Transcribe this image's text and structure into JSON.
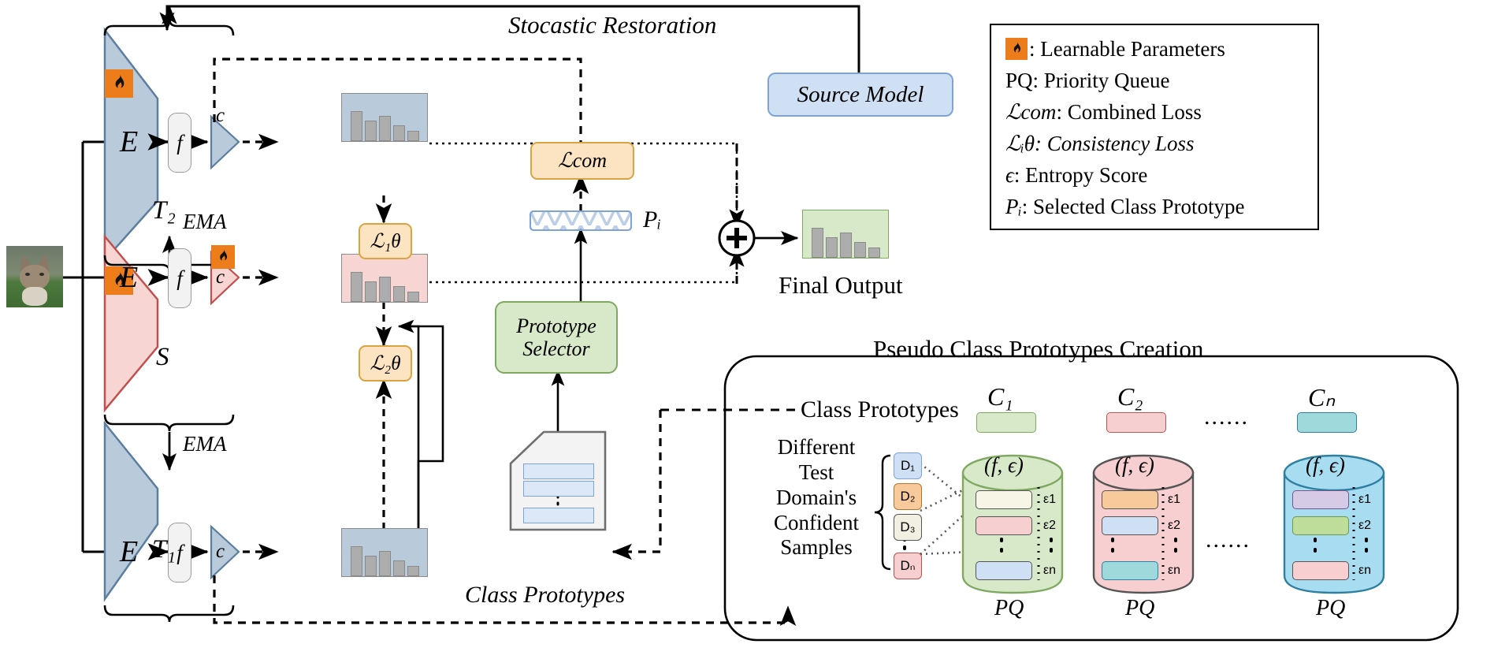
{
  "diagram": {
    "title_top": "Stocastic Restoration",
    "branches": [
      {
        "id": "T2",
        "label": "T₂",
        "encoder": "E",
        "feature": "f",
        "classifier": "c",
        "color": "#B9CBDB",
        "border": "#5C7E9E",
        "learnable_encoder": true,
        "learnable_classifier": false
      },
      {
        "id": "S",
        "label": "S",
        "encoder": "E",
        "feature": "f",
        "classifier": "c",
        "color": "#F6D5D3",
        "border": "#C0504D",
        "learnable_encoder": true,
        "learnable_classifier": true
      },
      {
        "id": "T1",
        "label": "T₁",
        "encoder": "E",
        "feature": "f",
        "classifier": "c",
        "color": "#B9CBDB",
        "border": "#5C7E9E",
        "learnable_encoder": false,
        "learnable_classifier": false
      }
    ],
    "ema_up_label": "EMA",
    "ema_down_label": "EMA",
    "losses": [
      {
        "id": "L1",
        "label": "ℒ₁θ"
      },
      {
        "id": "L2",
        "label": "ℒ₂θ"
      },
      {
        "id": "Lcom",
        "label": "ℒcom"
      }
    ],
    "pi_label": "Pᵢ",
    "prototype_selector": {
      "line1": "Prototype",
      "line2": "Selector"
    },
    "class_prototypes_caption": "Class Prototypes",
    "source_model": "Source Model",
    "final_output": "Final Output",
    "plus_symbol": "+"
  },
  "legend": {
    "items": [
      {
        "icon": "fire-icon",
        "key": "",
        "text": ": Learnable Parameters"
      },
      {
        "icon": "",
        "key": "PQ",
        "text": ": Priority Queue"
      },
      {
        "icon": "",
        "key": "ℒcom",
        "text": ": Combined Loss"
      },
      {
        "icon": "",
        "key": "ℒᵢθ",
        "text": ": Consistency Loss",
        "italic": true
      },
      {
        "icon": "",
        "key": "ϵ",
        "text": ": Entropy Score"
      },
      {
        "icon": "",
        "key": "Pᵢ",
        "text": ": Selected Class Prototype"
      }
    ]
  },
  "pseudo_panel": {
    "title": "Pseudo Class Prototypes Creation",
    "class_prototypes_label": "Class Prototypes",
    "samples_label_lines": [
      "Different",
      "Test",
      "Domain's",
      "Confident",
      "Samples"
    ],
    "ellipsis": "......",
    "domains": [
      {
        "label": "D₁",
        "color": "#CFE0F5"
      },
      {
        "label": "D₂",
        "color": "#F8C99A"
      },
      {
        "label": "D₃",
        "color": "#F2F0E2"
      },
      {
        "label": "Dₙ",
        "color": "#F8CFD0"
      }
    ],
    "classes": [
      {
        "label": "C₁",
        "swatch": "#D8E9CA",
        "cyl_fill": "#D8E9CA",
        "cyl_border": "#7FA961",
        "header": "(f, ϵ)",
        "pq_label": "PQ",
        "entries": [
          {
            "eps": "ε1",
            "color": "#F7F5E6"
          },
          {
            "eps": "ε2",
            "color": "#F6CFD0"
          },
          {
            "eps": "εn",
            "color": "#CFE0F5"
          }
        ]
      },
      {
        "label": "C₂",
        "swatch": "#F6CFD0",
        "cyl_fill": "#F8CFD0",
        "cyl_border": "#555555",
        "header": "(f, ϵ)",
        "pq_label": "PQ",
        "entries": [
          {
            "eps": "ε1",
            "color": "#F8C99A"
          },
          {
            "eps": "ε2",
            "color": "#CFE0F5"
          },
          {
            "eps": "εn",
            "color": "#9FD9DB"
          }
        ]
      },
      {
        "label": "Cₙ",
        "swatch": "#9FD9DB",
        "cyl_fill": "#A8DCF0",
        "cyl_border": "#2E7FA0",
        "header": "(f, ϵ)",
        "pq_label": "PQ",
        "entries": [
          {
            "eps": "ε1",
            "color": "#D5CBE6",
            "border": "#6E5A8C"
          },
          {
            "eps": "ε2",
            "color": "#BEDC9A",
            "border": "#6E9A4E"
          },
          {
            "eps": "εn",
            "color": "#F8CFD0",
            "border": "#555555"
          }
        ]
      }
    ]
  },
  "colors": {
    "teacher_fill": "#B9CBDB",
    "teacher_border": "#5C7E9E",
    "student_fill": "#F6D5D3",
    "student_border": "#C0504D",
    "loss_fill": "#FCE3C2",
    "loss_border": "#D9A441",
    "green_fill": "#D8E9CA",
    "green_border": "#7FA961",
    "blue_fill": "#CFE0F5",
    "blue_border": "#7FA4D4",
    "fire_badge": "#ED7D1B"
  }
}
